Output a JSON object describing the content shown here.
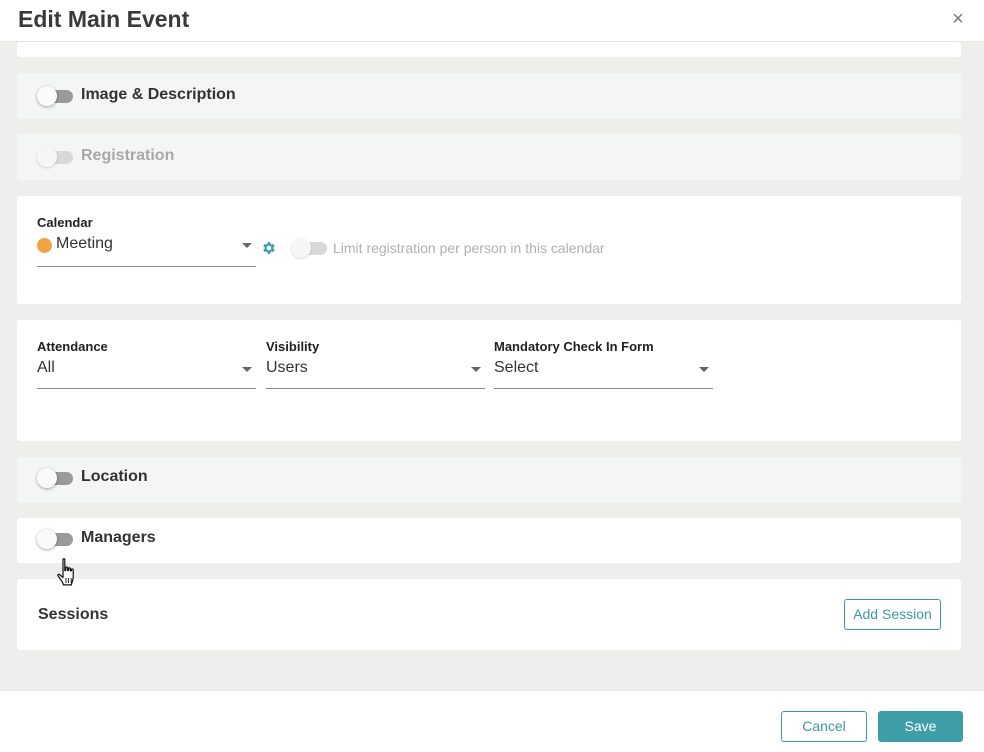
{
  "dialog": {
    "title": "Edit Main Event",
    "close_glyph": "×"
  },
  "sections": {
    "image_description": {
      "label": "Image & Description",
      "enabled": false
    },
    "registration": {
      "label": "Registration",
      "enabled": false,
      "disabled": true
    },
    "location": {
      "label": "Location",
      "enabled": false
    },
    "managers": {
      "label": "Managers",
      "enabled": false
    }
  },
  "calendar": {
    "label": "Calendar",
    "value": "Meeting",
    "dot_color": "#f2a343",
    "settings_icon": "gear-icon",
    "limit_label": "Limit registration per person in this calendar",
    "limit_enabled": false
  },
  "options": {
    "attendance": {
      "label": "Attendance",
      "value": "All"
    },
    "visibility": {
      "label": "Visibility",
      "value": "Users"
    },
    "checkin_form": {
      "label": "Mandatory Check In Form",
      "value": "Select"
    }
  },
  "sessions": {
    "label": "Sessions",
    "add_label": "Add Session"
  },
  "footer": {
    "cancel_label": "Cancel",
    "save_label": "Save"
  },
  "colors": {
    "accent": "#3d9ea8",
    "background": "#eeeeed"
  }
}
